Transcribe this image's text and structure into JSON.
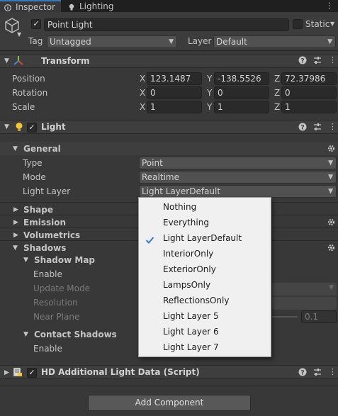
{
  "tabs": {
    "inspector": "Inspector",
    "lighting": "Lighting"
  },
  "object": {
    "name": "Point Light",
    "static_label": "Static",
    "tag_label": "Tag",
    "tag_value": "Untagged",
    "layer_label": "Layer",
    "layer_value": "Default"
  },
  "transform": {
    "title": "Transform",
    "rows": [
      {
        "label": "Position",
        "x": "123.1487",
        "y": "-138.5526",
        "z": "72.37986"
      },
      {
        "label": "Rotation",
        "x": "0",
        "y": "0",
        "z": "0"
      },
      {
        "label": "Scale",
        "x": "1",
        "y": "1",
        "z": "1"
      }
    ],
    "axis": {
      "x": "X",
      "y": "Y",
      "z": "Z"
    }
  },
  "light": {
    "title": "Light",
    "general": "General",
    "type_label": "Type",
    "type_value": "Point",
    "mode_label": "Mode",
    "mode_value": "Realtime",
    "layer_label": "Light Layer",
    "layer_value": "Light LayerDefault",
    "shape": "Shape",
    "emission": "Emission",
    "volumetrics": "Volumetrics",
    "shadows": "Shadows",
    "shadow_map": "Shadow Map",
    "enable": "Enable",
    "update_mode": "Update Mode",
    "resolution": "Resolution",
    "near_plane": "Near Plane",
    "near_plane_value": "0.1",
    "contact_shadows": "Contact Shadows",
    "contact_enable": "Enable"
  },
  "popup": {
    "items": [
      "Nothing",
      "Everything",
      "Light LayerDefault",
      "InteriorOnly",
      "ExteriorOnly",
      "LampsOnly",
      "ReflectionsOnly",
      "Light Layer 5",
      "Light Layer 6",
      "Light Layer 7"
    ],
    "checked_index": 2
  },
  "hd_data": {
    "title": "HD Additional Light Data (Script)"
  },
  "add_component": "Add Component",
  "colors": {
    "accent": "#3a79bb",
    "check_blue": "#2f7bd4"
  }
}
